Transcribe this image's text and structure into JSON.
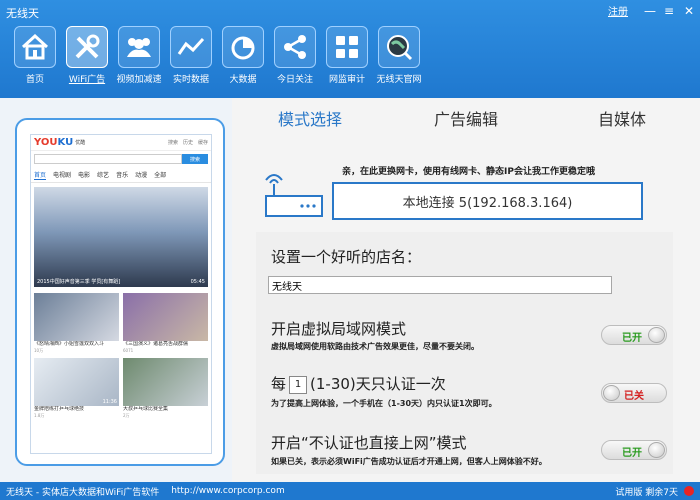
{
  "window": {
    "title": "无线天",
    "register": "注册",
    "minimize": "—",
    "menu": "≡",
    "close": "✕"
  },
  "toolbar": [
    {
      "label": "首页",
      "icon": "home-icon"
    },
    {
      "label": "WiFi广告",
      "icon": "tools-icon",
      "active": true
    },
    {
      "label": "视频加减速",
      "icon": "users-icon"
    },
    {
      "label": "实时数据",
      "icon": "line-chart-icon"
    },
    {
      "label": "大数据",
      "icon": "pie-chart-icon"
    },
    {
      "label": "今日关注",
      "icon": "share-icon"
    },
    {
      "label": "网监审计",
      "icon": "grid-icon"
    },
    {
      "label": "无线天官网",
      "icon": "globe-icon"
    }
  ],
  "phone": {
    "logo_a": "YOU",
    "logo_b": "KU",
    "logo_sub": "优酷",
    "header_icons": [
      "搜索",
      "历史",
      "缓存"
    ],
    "search_button": "搜索",
    "nav": [
      "首页",
      "电视剧",
      "电影",
      "综艺",
      "音乐",
      "动漫",
      "全部"
    ],
    "hero_caption": "2015中国好声音第三季 学员[有舞蹈]",
    "hero_time": "05:45",
    "thumbs": [
      {
        "title": "《怒晴湘西》小姐雪莲双双入斗",
        "stats": "10万",
        "duration": ""
      },
      {
        "title": "《三国演义》诸葛亮舌战群儒",
        "stats": "6071",
        "duration": ""
      },
      {
        "title": "金牌陪练打乒乓球绝技",
        "stats": "1.8万",
        "duration": "11:36"
      },
      {
        "title": "大叔乒乓球比赛全集",
        "stats": "2万",
        "duration": ""
      }
    ]
  },
  "tabs": [
    {
      "label": "模式选择",
      "active": true
    },
    {
      "label": "广告编辑"
    },
    {
      "label": "自媒体"
    }
  ],
  "network": {
    "notice": "亲，在此更换网卡，使用有线网卡、静态IP会让我工作更稳定哦",
    "connection": "本地连接 5(192.168.3.164)"
  },
  "shop": {
    "label": "设置一个好听的店名：",
    "value": "无线天"
  },
  "options": {
    "virtual_lan": {
      "title": "开启虚拟局域网模式",
      "desc": "虚拟局域网使用软路由技术广告效果更佳，尽量不要关闭。",
      "state": "已开"
    },
    "auth_days": {
      "title_pre": "每",
      "days": "1",
      "title_post": "(1-30)天只认证一次",
      "desc": "为了提高上网体验，一个手机在（1-30天）内只认证1次即可。",
      "state": "已关"
    },
    "no_auth": {
      "title": "开启“不认证也直接上网”模式",
      "desc": "如果已关，表示必须WiFi广告成功认证后才开通上网，但客人上网体验不好。",
      "state": "已开"
    }
  },
  "status": {
    "text": "无线天 - 实体店大数据和WiFi广告软件",
    "url": "http://www.corpcorp.com",
    "trial": "试用版 剩余7天"
  },
  "colors": {
    "accent": "#2a78c8",
    "header": "#1f78cf",
    "on": "#2a9b1f",
    "off": "#d42020"
  }
}
